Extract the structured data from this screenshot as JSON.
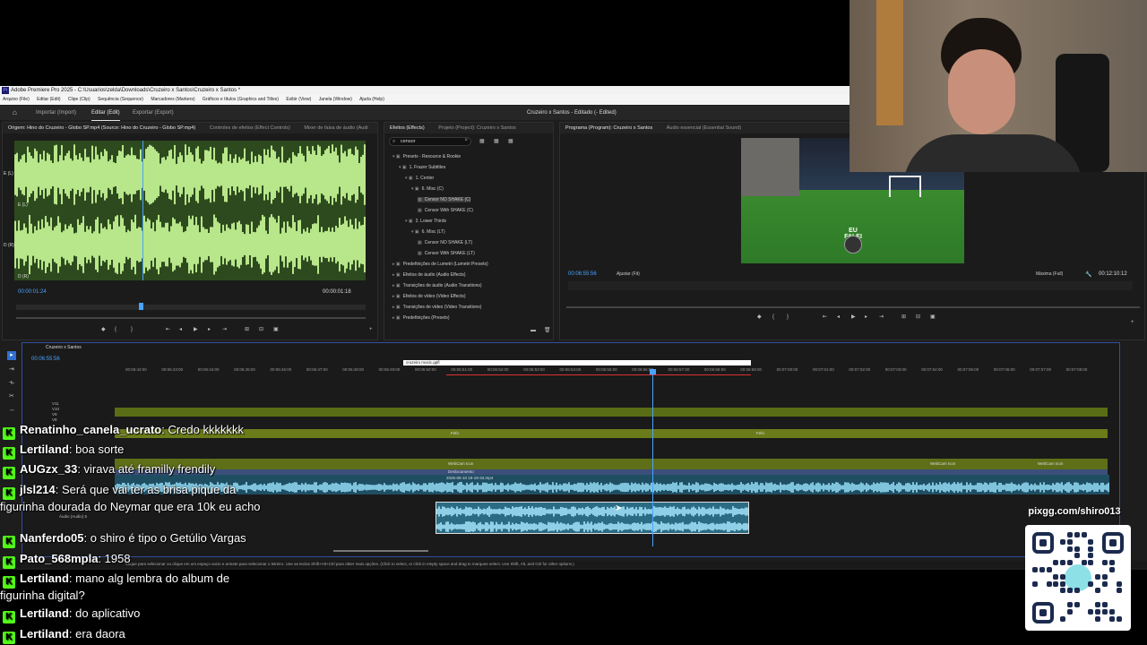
{
  "window": {
    "title": "Adobe Premiere Pro 2025 - C:\\Usuarios\\zelda\\Downloads\\Cruzeiro x Santos\\Cruzeiro x Santos *",
    "menu": [
      "Arquivo (File)",
      "Editar (Edit)",
      "Clipe (Clip)",
      "Sequência (Sequence)",
      "Marcadores (Markers)",
      "Gráficos e títulos (Graphics and Titles)",
      "Exibir (View)",
      "Janela (Window)",
      "Ajuda (Help)"
    ]
  },
  "header": {
    "tabs": [
      "Importar (Import)",
      "Editar (Edit)",
      "Exportar (Export)"
    ],
    "active_tab": "Editar (Edit)",
    "project_title": "Cruzeiro x Santos - Editado (- Edited)"
  },
  "source_panel": {
    "tabs": [
      "Origem: Hino do Cruzeiro - Globo SP.mp4 (Source: Hino do Cruzeiro - Globo SP.mp4)",
      "Controles de efeitos (Effect Controls)",
      "Mixer de faixa de áudio (Audi"
    ],
    "timecode_current": "00:00:01:24",
    "timecode_duration": "00:00:01:18",
    "channel_labels": [
      "E (L)",
      "E (L)",
      "D (R)",
      "D (R)"
    ]
  },
  "effects_panel": {
    "tabs": [
      "Efeitos (Effects)",
      "Projeto (Project): Cruzeiro x Santos"
    ],
    "search_value": "censor",
    "tree": [
      "Presets - Resource & Rookie",
      "1. Frazer Subtitles",
      "1. Center",
      "6. Misc (C)",
      "Censor NO SHAKE (C)",
      "Censor With SHAKE (C)",
      "2. Lower Thirds",
      "6. Misc (LT)",
      "Censor NO SHAKE (LT)",
      "Censor With SHAKE (LT)",
      "Predefinições de Lumetri (Lumetri Presets)",
      "Efeitos de áudio (Audio Effects)",
      "Transições de áudio (Audio Transitions)",
      "Efeitos de vídeo (Video Effects)",
      "Transições de vídeo (Video Transitions)",
      "Predefinições (Presets)"
    ],
    "selected_item": "Censor NO SHAKE (C)"
  },
  "program_panel": {
    "tabs": [
      "Programa (Program): Cruzeiro x Santos",
      "Áudio essencial (Essential Sound)"
    ],
    "timecode_current": "00:06:55:56",
    "fit_label": "Ajustar (Fit)",
    "quality_label": "Máxima (Full)",
    "timecode_duration": "00:12:10:12",
    "overlay_text": "EU FALEI"
  },
  "timeline": {
    "sequence_name": "Cruzeiro x Santos",
    "timecode": "00:06:55:56",
    "marker_label": "cruzeiro music.gpfl",
    "ruler": [
      "00:06:42:00",
      "00:06:43:00",
      "00:06:44:00",
      "00:06:45:00",
      "00:06:46:00",
      "00:06:47:00",
      "00:06:48:00",
      "00:06:49:00",
      "00:06:50:00",
      "00:06:51:00",
      "00:06:52:00",
      "00:06:53:00",
      "00:06:54:00",
      "00:06:55:00",
      "00:06:56:00",
      "00:06:57:00",
      "00:06:58:00",
      "00:06:59:00",
      "00:07:00:00",
      "00:07:01:00",
      "00:07:02:00",
      "00:07:03:00",
      "00:07:04:00",
      "00:07:05:00",
      "00:07:06:00",
      "00:07:07:00",
      "00:07:08:00"
    ],
    "tracks": [
      "V11",
      "V10",
      "V9",
      "V8"
    ],
    "clip_labels": {
      "fefo": "Fefo",
      "webcam": "WebCam Icon",
      "deslocamento": "Deslocamento",
      "video_file": "2025-06-10 19-19-34.mp4",
      "audio_track": "Áudio (Audio) 5"
    },
    "status": "Clique para selecionar ou clique em um espaço vazio e arraste para selecionar o letreiro. Use as teclas Shift+Alt+Ctrl para obter mais opções. (Click to select, or click in empty space and drag to marquee select. Use Shift, Alt, and Ctrl for other options.)"
  },
  "chat": [
    {
      "user": "Renatinho_canela_ucrato",
      "message": "Credo kkkkkkk"
    },
    {
      "user": "Lertiland",
      "message": "boa sorte"
    },
    {
      "user": "AUGzx_33",
      "message": "virava até framilly frendily"
    },
    {
      "user": "jlsl214",
      "message": "Será que vai ter as brisa pique da figurinha dourada do Neymar que era 10k eu acho"
    },
    {
      "user": "Nanferdo05",
      "message": "o shiro é tipo o Getúlio Vargas"
    },
    {
      "user": "Pato_568mpla",
      "message": "1958"
    },
    {
      "user": "Lertiland",
      "message": "mano alg lembra do album de figurinha digital?"
    },
    {
      "user": "Lertiland",
      "message": "do aplicativo"
    },
    {
      "user": "Lertiland",
      "message": "era daora"
    }
  ],
  "qr": {
    "url": "pixgg.com/shiro013"
  },
  "colors": {
    "waveform_bg": "#2d4a1e",
    "waveform_fg": "#b8e68a",
    "playhead": "#4aa3ff",
    "chat_badge": "#53fc18",
    "timeline_border": "#2f4fa0",
    "audio_clip": "#2b6b83"
  }
}
